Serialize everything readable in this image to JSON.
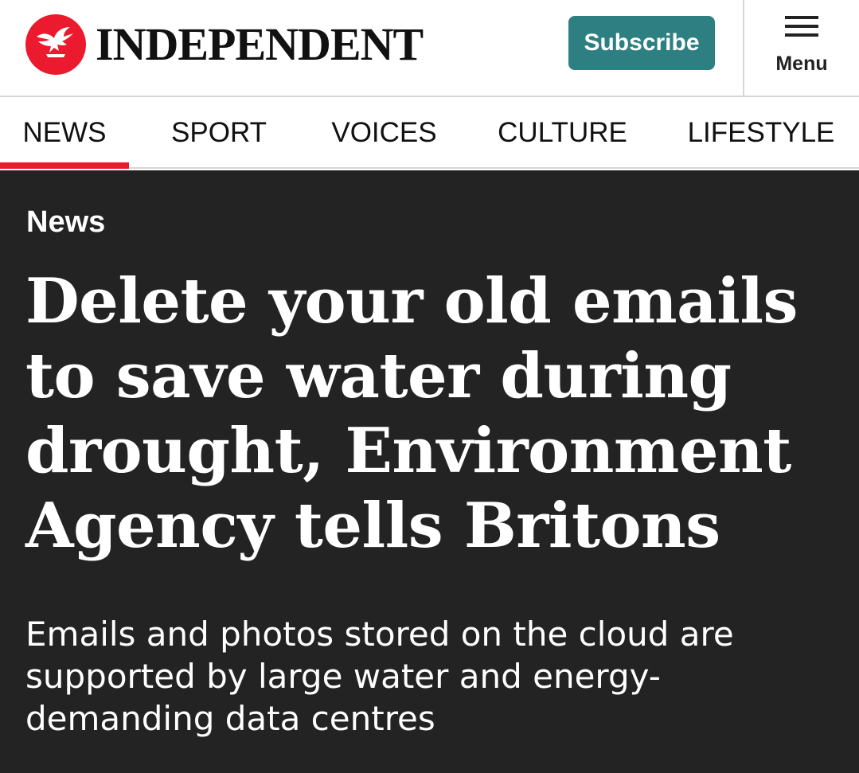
{
  "header": {
    "logo_text": "INDEPENDENT",
    "subscribe_label": "Subscribe",
    "menu_label": "Menu",
    "logo_icon": "eagle-icon",
    "menu_icon": "hamburger-icon"
  },
  "nav": {
    "tabs": [
      {
        "label": "NEWS",
        "active": true
      },
      {
        "label": "SPORT",
        "active": false
      },
      {
        "label": "VOICES",
        "active": false
      },
      {
        "label": "CULTURE",
        "active": false
      },
      {
        "label": "LIFESTYLE",
        "active": false
      }
    ]
  },
  "article": {
    "section": "News",
    "headline": "Delete your old emails to save water during drought, Environment Agency tells Britons",
    "standfirst": "Emails and photos stored on the cloud are supported by large water and energy-demanding data centres"
  },
  "colors": {
    "brand_red": "#ec1a2e",
    "subscribe_teal": "#2d7f82",
    "article_bg": "#232323"
  }
}
